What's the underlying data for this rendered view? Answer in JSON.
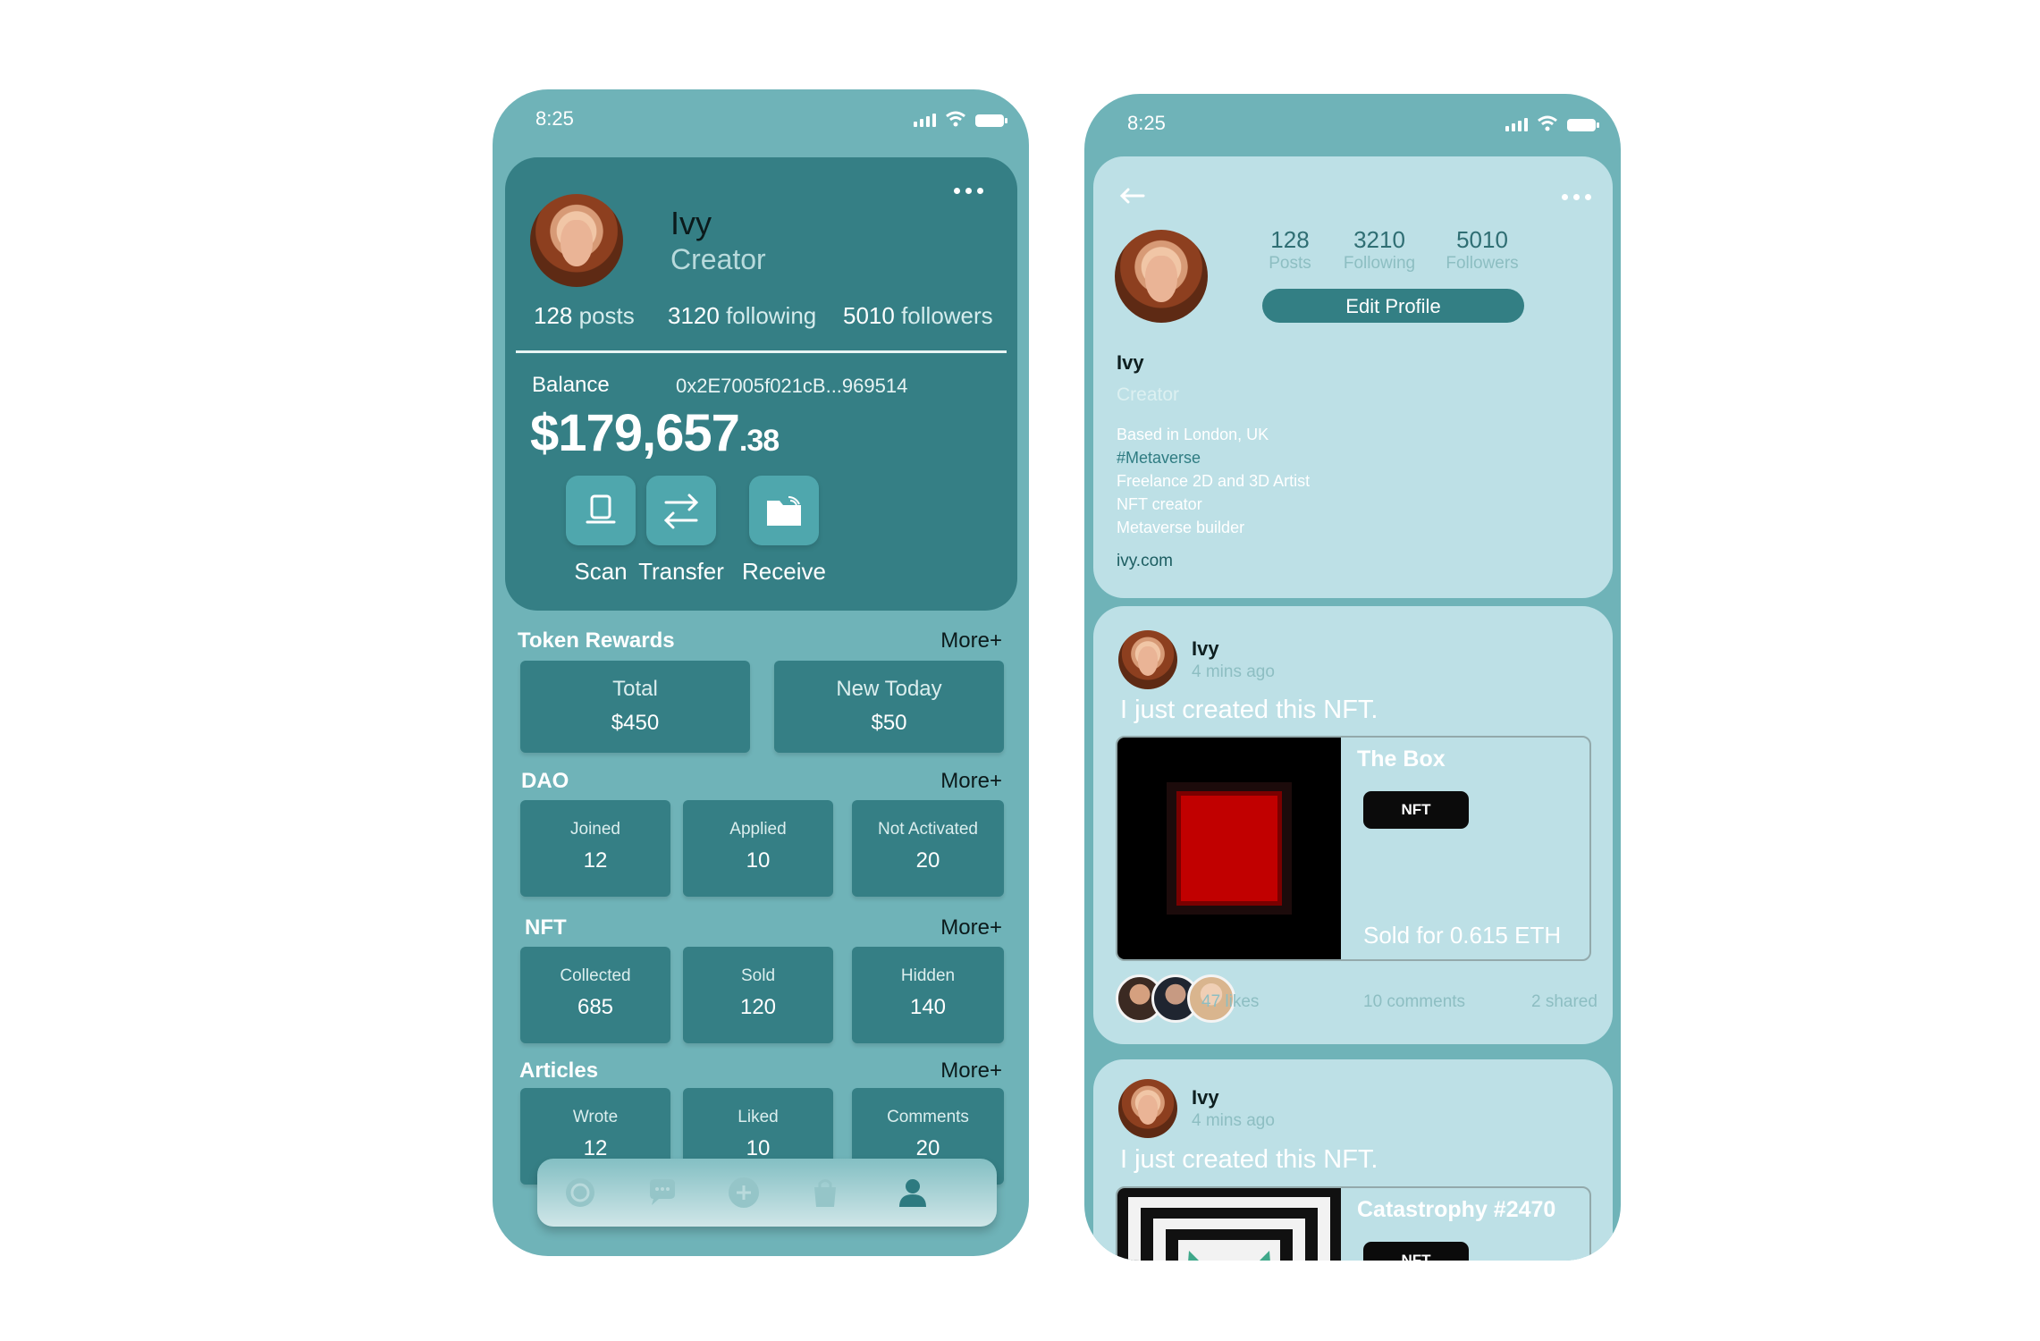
{
  "profile_screen": {
    "status": {
      "time": "8:25"
    },
    "user": {
      "name": "Ivy",
      "role": "Creator",
      "posts_count": "128",
      "posts_label": "posts",
      "following_count": "3120",
      "following_label": "following",
      "followers_count": "5010",
      "followers_label": "followers"
    },
    "balance": {
      "label": "Balance",
      "address": "0x2E7005f021cB...969514",
      "amount_main": "$179,657",
      "amount_cents": ".38"
    },
    "actions": [
      {
        "label": "Scan",
        "icon": "scan-icon"
      },
      {
        "label": "Transfer",
        "icon": "transfer-icon"
      },
      {
        "label": "Receive",
        "icon": "receive-folder-icon"
      }
    ],
    "token_rewards": {
      "title": "Token Rewards",
      "more": "More+",
      "items": [
        {
          "label": "Total",
          "value": "$450"
        },
        {
          "label": "New Today",
          "value": "$50"
        }
      ]
    },
    "dao": {
      "title": "DAO",
      "more": "More+",
      "items": [
        {
          "label": "Joined",
          "value": "12"
        },
        {
          "label": "Applied",
          "value": "10"
        },
        {
          "label": "Not Activated",
          "value": "20"
        }
      ]
    },
    "nft": {
      "title": "NFT",
      "more": "More+",
      "items": [
        {
          "label": "Collected",
          "value": "685"
        },
        {
          "label": "Sold",
          "value": "120"
        },
        {
          "label": "Hidden",
          "value": "140"
        }
      ]
    },
    "articles": {
      "title": "Articles",
      "more": "More+",
      "items": [
        {
          "label": "Wrote",
          "value": "12"
        },
        {
          "label": "Liked",
          "value": "10"
        },
        {
          "label": "Comments",
          "value": "20"
        }
      ]
    },
    "nav": [
      "explore-icon",
      "chat-icon",
      "add-icon",
      "shop-bag-icon",
      "profile-icon"
    ]
  },
  "public_profile_screen": {
    "status": {
      "time": "8:25"
    },
    "stats": [
      {
        "number": "128",
        "label": "Posts"
      },
      {
        "number": "3210",
        "label": "Following"
      },
      {
        "number": "5010",
        "label": "Followers"
      }
    ],
    "edit_button": "Edit Profile",
    "name": "Ivy",
    "role": "Creator",
    "bio": [
      "Based in London, UK",
      "#Metaverse",
      "Freelance 2D and 3D Artist",
      "NFT creator",
      "Metaverse builder"
    ],
    "link": "ivy.com",
    "posts": [
      {
        "author": "Ivy",
        "time": "4 mins ago",
        "text": "I just created this NFT.",
        "nft_title": "The Box",
        "badge": "NFT",
        "sold": "Sold for 0.615 ETH",
        "likes": "47 likes",
        "comments": "10 comments",
        "shared": "2 shared"
      },
      {
        "author": "Ivy",
        "time": "4 mins ago",
        "text": "I just created this NFT.",
        "nft_title": "Catastrophy #2470",
        "badge": "NFT"
      }
    ]
  }
}
